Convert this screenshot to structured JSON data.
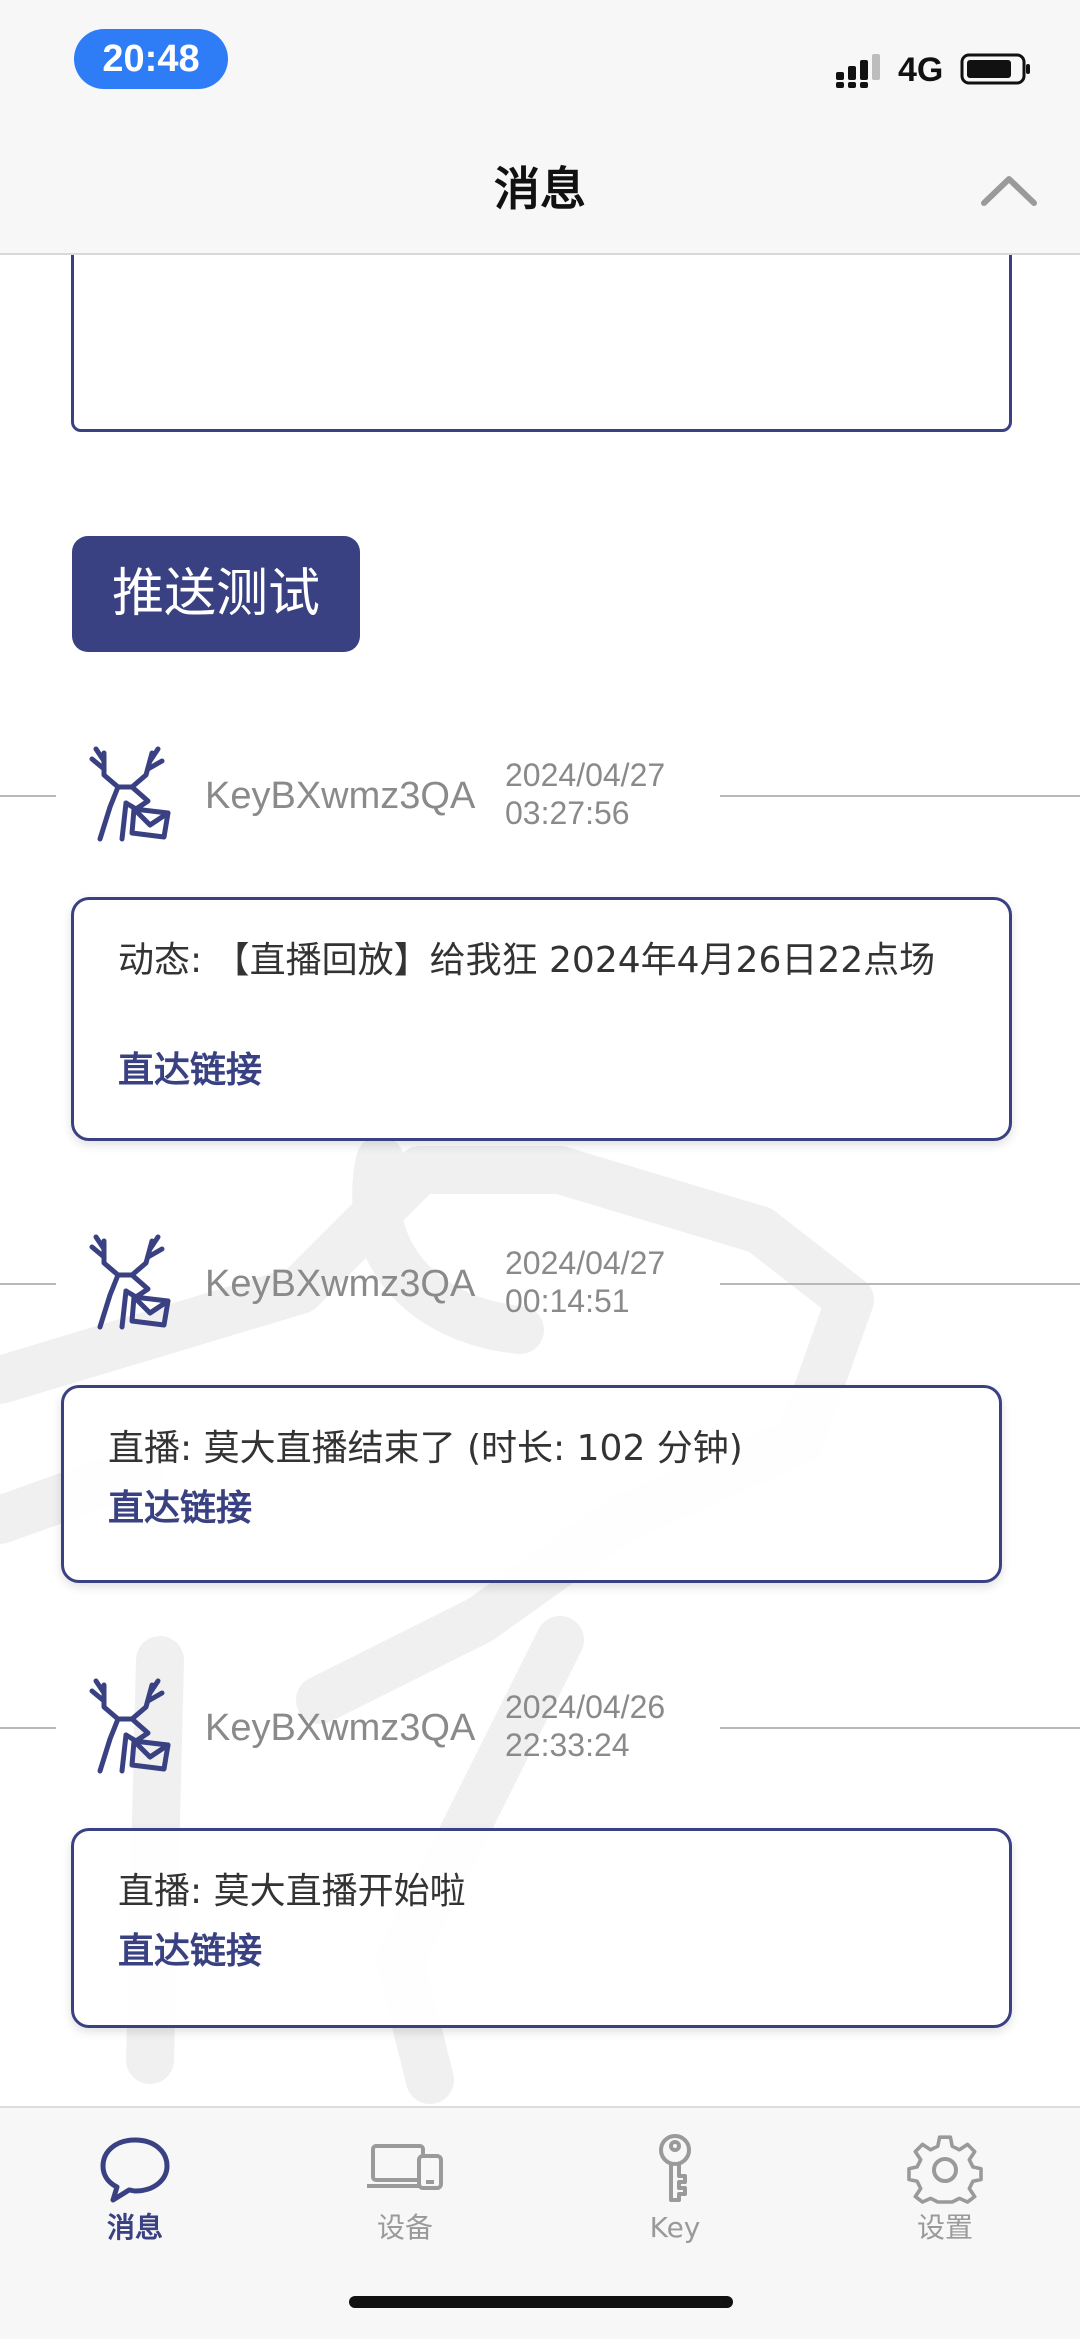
{
  "status_bar": {
    "time": "20:48",
    "network": "4G"
  },
  "nav": {
    "title": "消息"
  },
  "composer": {
    "push_test_label": "推送测试"
  },
  "messages": [
    {
      "sender": "KeyBXwmz3QA",
      "date": "2024/04/27",
      "time": "03:27:56",
      "body": "动态: 【直播回放】给我狂 2024年4月26日22点场",
      "link": "直达链接"
    },
    {
      "sender": "KeyBXwmz3QA",
      "date": "2024/04/27",
      "time": "00:14:51",
      "body": "直播: 莫大直播结束了 (时长: 102 分钟)",
      "link": "直达链接"
    },
    {
      "sender": "KeyBXwmz3QA",
      "date": "2024/04/26",
      "time": "22:33:24",
      "body": "直播: 莫大直播开始啦",
      "link": "直达链接"
    }
  ],
  "tabs": [
    {
      "label": "消息",
      "icon": "chat-bubble-icon",
      "active": true
    },
    {
      "label": "设备",
      "icon": "devices-icon",
      "active": false
    },
    {
      "label": "Key",
      "icon": "key-icon",
      "active": false
    },
    {
      "label": "设置",
      "icon": "gear-icon",
      "active": false
    }
  ],
  "colors": {
    "accent": "#3a4182",
    "status_pill": "#2f7df6",
    "muted_text": "#8a8a8a"
  }
}
